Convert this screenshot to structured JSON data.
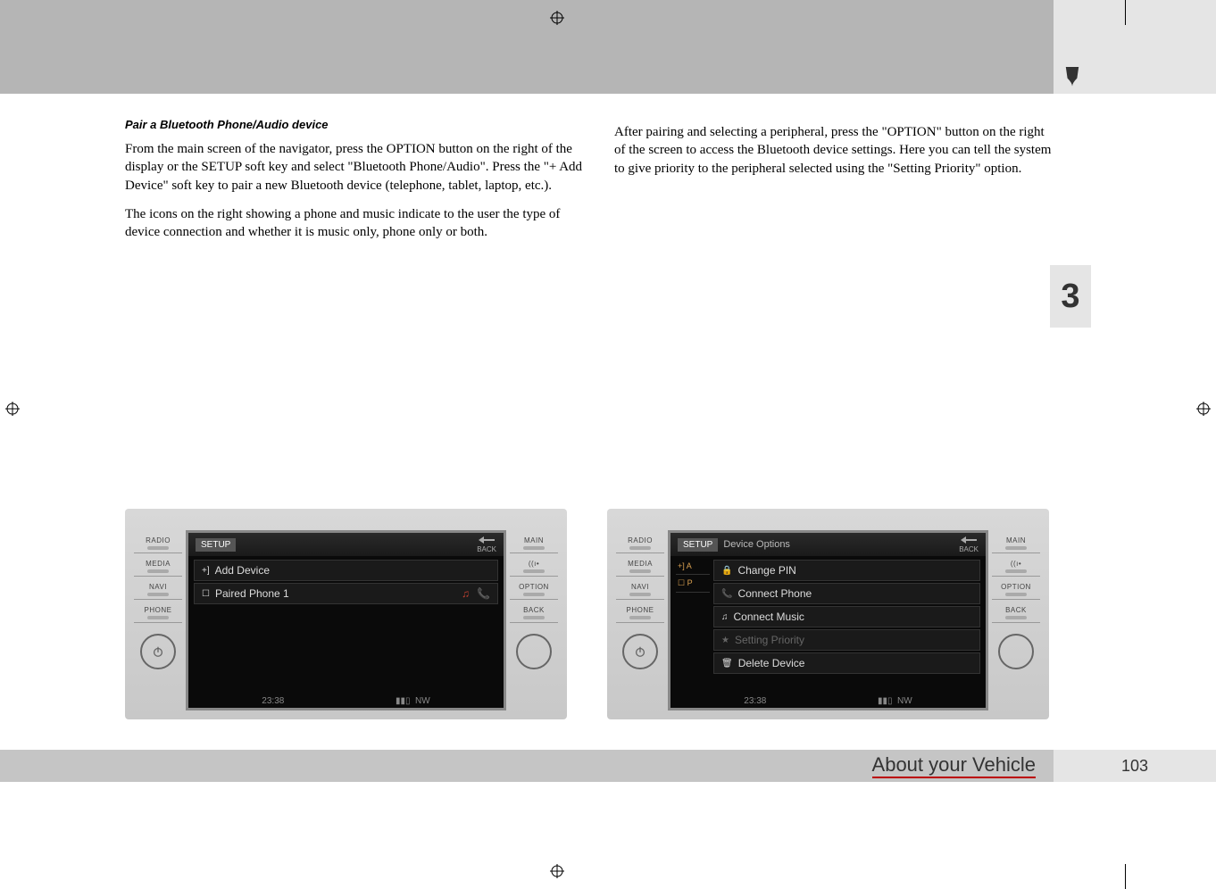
{
  "header": {},
  "chapter": {
    "number": "3"
  },
  "left_col": {
    "heading": "Pair a Bluetooth Phone/Audio device",
    "p1": "From the main screen of the navigator, press the OPTION button on the right of the display or the SETUP soft key and select \"Bluetooth Phone/Audio\". Press the \"+ Add Device\" soft key to pair a new Bluetooth device (telephone, tablet, laptop, etc.).",
    "p2": "The icons on the right showing a phone and music indicate to the user the type of device connection and whether it is music only, phone only or both."
  },
  "right_col": {
    "p1": "After pairing and selecting a peripheral, press the \"OPTION\" button on the right of the screen to access the Bluetooth device settings. Here you can tell the system to give priority to the peripheral selected using the \"Setting Priority\" option."
  },
  "side_buttons_left": [
    "RADIO",
    "MEDIA",
    "NAVI",
    "PHONE"
  ],
  "side_buttons_right": [
    "MAIN",
    "",
    "OPTION",
    "BACK"
  ],
  "screen1": {
    "header_tag": "SETUP",
    "back_label": "BACK",
    "rows": [
      {
        "icon": "+]",
        "label": "Add Device",
        "right": []
      },
      {
        "icon": "☐",
        "label": "Paired Phone 1",
        "right": [
          "♫",
          "📞"
        ]
      }
    ],
    "status": {
      "time": "23:38",
      "signal": "▮▮▯",
      "compass": "NW"
    }
  },
  "screen2": {
    "header_tag": "SETUP",
    "header_title": "Device Options",
    "back_label": "BACK",
    "sub_left": [
      "+] A",
      "☐ P"
    ],
    "rows": [
      {
        "icon": "🔒",
        "label": "Change PIN",
        "dim": false
      },
      {
        "icon": "📞",
        "label": "Connect Phone",
        "dim": false
      },
      {
        "icon": "♫",
        "label": "Connect Music",
        "dim": false
      },
      {
        "icon": "★",
        "label": "Setting Priority",
        "dim": true
      },
      {
        "icon": "🗑",
        "label": "Delete Device",
        "dim": false
      }
    ],
    "status": {
      "time": "23:38",
      "signal": "▮▮▯",
      "compass": "NW"
    }
  },
  "footer": {
    "section": "About your Vehicle",
    "page": "103"
  },
  "icons": {
    "signal_glyph": "((ı•"
  }
}
